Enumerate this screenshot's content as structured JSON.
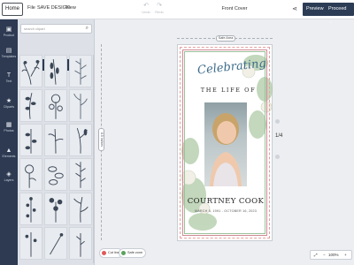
{
  "topbar": {
    "home_label": "Home",
    "menu": [
      "File",
      "SAVE DESIGN",
      "View"
    ],
    "undo_label": "Undo",
    "redo_label": "Redo",
    "document_title": "Front Cover",
    "preview_label": "Preview",
    "proceed_label": "Proceed"
  },
  "leftnav": {
    "items": [
      {
        "label": "Product",
        "icon": "product-icon"
      },
      {
        "label": "Templates",
        "icon": "templates-icon"
      },
      {
        "label": "Text",
        "icon": "text-icon"
      },
      {
        "label": "Cliparts",
        "icon": "star-icon"
      },
      {
        "label": "Photos",
        "icon": "image-icon"
      },
      {
        "label": "Elements",
        "icon": "shapes-icon"
      },
      {
        "label": "Layers",
        "icon": "layers-icon"
      }
    ]
  },
  "panel": {
    "search_placeholder": "search clipart",
    "category": "Flowers"
  },
  "canvas": {
    "safe_area_label": "Safe Area",
    "size_label": "8.5 inches",
    "page_indicator": "1/4"
  },
  "cover": {
    "script_title": "Celebrating",
    "subtitle": "THE LIFE OF",
    "name": "COURTNEY COOK",
    "dates": "MARCH 5, 1991 - OCTOBER 16, 2023"
  },
  "bottom": {
    "cut_line_label": "Cut line",
    "safe_zone_label": "Safe zone",
    "zoom": "100%"
  },
  "colors": {
    "nav_bg": "#2d3a52",
    "accent_button": "#2c3c55",
    "cut_line_dot": "#e05a5a",
    "safe_zone_dot": "#5aa35a"
  }
}
